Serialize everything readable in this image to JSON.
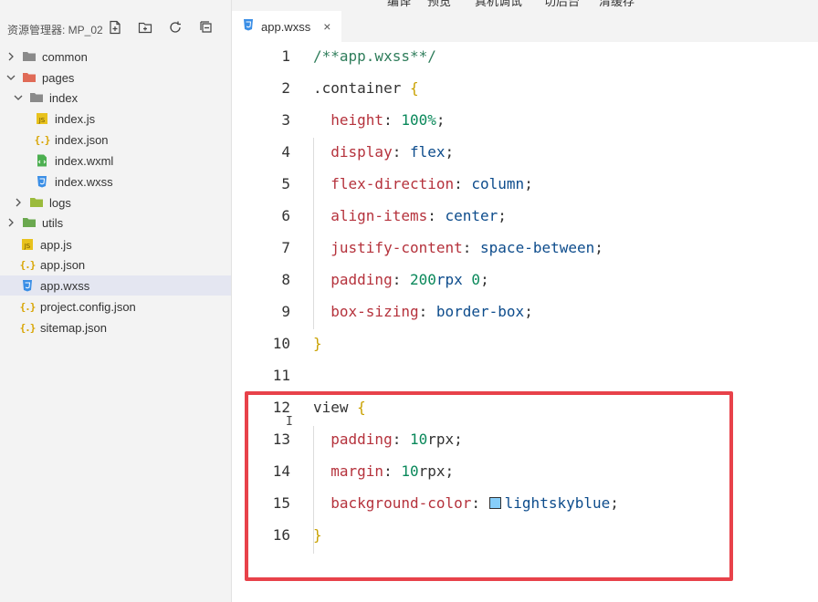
{
  "toolbar": {
    "items": [
      "编译",
      "预览",
      "真机调试",
      "切后台",
      "清缓存"
    ]
  },
  "sidebar": {
    "title": "资源管理器: MP_02",
    "actions": [
      "new-file",
      "new-folder",
      "refresh",
      "collapse-all"
    ],
    "tree": [
      {
        "label": "common",
        "type": "folder",
        "expanded": false
      },
      {
        "label": "pages",
        "type": "folder",
        "expanded": true
      },
      {
        "label": "index",
        "type": "folder",
        "expanded": true
      },
      {
        "label": "index.js",
        "type": "js"
      },
      {
        "label": "index.json",
        "type": "json"
      },
      {
        "label": "index.wxml",
        "type": "wxml"
      },
      {
        "label": "index.wxss",
        "type": "wxss"
      },
      {
        "label": "logs",
        "type": "folder",
        "expanded": false
      },
      {
        "label": "utils",
        "type": "folder",
        "expanded": false
      },
      {
        "label": "app.js",
        "type": "js"
      },
      {
        "label": "app.json",
        "type": "json"
      },
      {
        "label": "app.wxss",
        "type": "wxss",
        "selected": true
      },
      {
        "label": "project.config.json",
        "type": "json"
      },
      {
        "label": "sitemap.json",
        "type": "json"
      }
    ]
  },
  "editor": {
    "tab": {
      "label": "app.wxss",
      "close": "×"
    },
    "lines": [
      {
        "n": "1",
        "text": "/**app.wxss**/"
      },
      {
        "n": "2",
        "text": ".container {"
      },
      {
        "n": "3",
        "text": "  height: 100%;"
      },
      {
        "n": "4",
        "text": "  display: flex;"
      },
      {
        "n": "5",
        "text": "  flex-direction: column;"
      },
      {
        "n": "6",
        "text": "  align-items: center;"
      },
      {
        "n": "7",
        "text": "  justify-content: space-between;"
      },
      {
        "n": "8",
        "text": "  padding: 200rpx 0;"
      },
      {
        "n": "9",
        "text": "  box-sizing: border-box;"
      },
      {
        "n": "10",
        "text": "}"
      },
      {
        "n": "11",
        "text": ""
      },
      {
        "n": "12",
        "text": "view {"
      },
      {
        "n": "13",
        "text": "  padding: 10rpx;"
      },
      {
        "n": "14",
        "text": "  margin: 10rpx;"
      },
      {
        "n": "15",
        "text": "  background-color: lightskyblue;"
      },
      {
        "n": "16",
        "text": "}"
      }
    ]
  },
  "colors": {
    "highlight_box": "#e8424a",
    "swatch": "#87cefa",
    "selected_row": "#e4e6f1"
  }
}
